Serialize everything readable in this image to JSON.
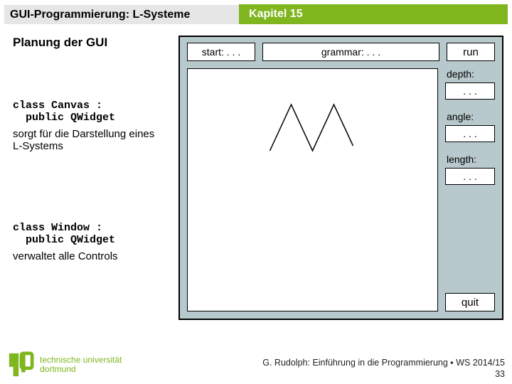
{
  "header": {
    "left": "GUI-Programmierung: L-Systeme",
    "right": "Kapitel 15"
  },
  "subtitle": "Planung der GUI",
  "left": {
    "code1": "class Canvas :\n  public QWidget",
    "desc1": "sorgt für die Darstellung eines L-Systems",
    "code2": "class Window :\n  public QWidget",
    "desc2": "verwaltet alle Controls"
  },
  "mock": {
    "start": "start: . . .",
    "grammar": "grammar: . . .",
    "run": "run",
    "depth_label": "depth:",
    "depth_value": ". . .",
    "angle_label": "angle:",
    "angle_value": ". . .",
    "length_label": "length:",
    "length_value": ". . .",
    "quit": "quit"
  },
  "footer": {
    "line1": "G. Rudolph: Einführung in die Programmierung ▪ WS 2014/15",
    "line2": "33"
  },
  "logo": {
    "line1": "technische universität",
    "line2": "dortmund"
  }
}
